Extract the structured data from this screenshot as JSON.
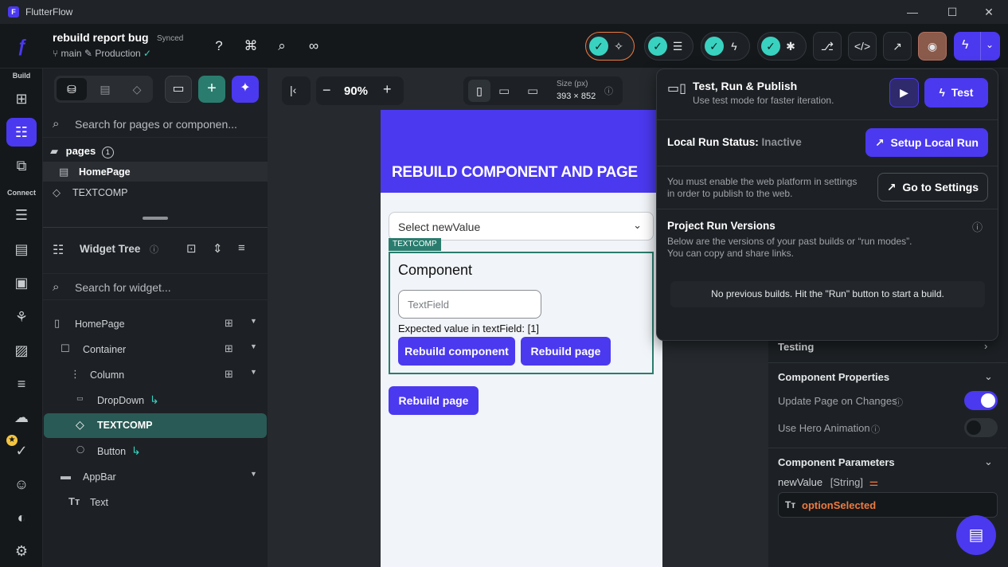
{
  "window": {
    "app_title": "FlutterFlow",
    "controls": [
      "—",
      "☐",
      "✕"
    ]
  },
  "project": {
    "name": "rebuild report bug",
    "sync_status": "Synced",
    "branch": "main",
    "environment": "Production"
  },
  "rail": {
    "build_label": "Build",
    "connect_label": "Connect"
  },
  "left_panel": {
    "search_pages_placeholder": "Search for pages or componen...",
    "pages_label": "pages",
    "pages_count": "1",
    "page_items": [
      "HomePage",
      "TEXTCOMP"
    ],
    "widget_tree_label": "Widget Tree",
    "search_widget_placeholder": "Search for widget...",
    "tree": [
      {
        "label": "HomePage"
      },
      {
        "label": "Container"
      },
      {
        "label": "Column"
      },
      {
        "label": "DropDown"
      },
      {
        "label": "TEXTCOMP"
      },
      {
        "label": "Button"
      },
      {
        "label": "AppBar"
      },
      {
        "label": "Text"
      }
    ]
  },
  "canvas": {
    "zoom": "90%",
    "size_label": "Size (px)",
    "size_value": "393 × 852"
  },
  "phone": {
    "appbar_title": "REBUILD COMPONENT AND PAGE",
    "dropdown_value": "Select newValue",
    "component_tag": "TEXTCOMP",
    "component_title": "Component",
    "textfield_placeholder": "TextField",
    "expected_text": "Expected value in textField: [1]",
    "btn_rebuild_component": "Rebuild component",
    "btn_rebuild_page_inner": "Rebuild page",
    "btn_rebuild_page_outer": "Rebuild page"
  },
  "popup": {
    "title": "Test, Run & Publish",
    "subtitle": "Use test mode for faster iteration.",
    "test_button": "Test",
    "local_run_label": "Local Run Status:",
    "local_run_status": "Inactive",
    "setup_button": "Setup Local Run",
    "web_notice_1": "You must enable the web platform in settings",
    "web_notice_2": "in order to publish to the web.",
    "settings_button": "Go to Settings",
    "versions_title": "Project Run Versions",
    "versions_desc_1": "Below are the versions of your past builds or “run modes”.",
    "versions_desc_2": "You can copy and share links.",
    "no_builds": "No previous builds. Hit the \"Run\" button to start a build."
  },
  "properties": {
    "testing": "Testing",
    "component_properties": "Component Properties",
    "update_page": "Update Page on Changes",
    "update_page_enabled": true,
    "hero_animation": "Use Hero Animation",
    "hero_animation_enabled": false,
    "component_parameters": "Component Parameters",
    "param_name": "newValue",
    "param_type": "[String]",
    "param_value": "optionSelected"
  },
  "colors": {
    "primary": "#4b39ef",
    "accent": "#39d2c0",
    "component_border": "#2a7d6e",
    "param_value": "#ef7a3f"
  }
}
